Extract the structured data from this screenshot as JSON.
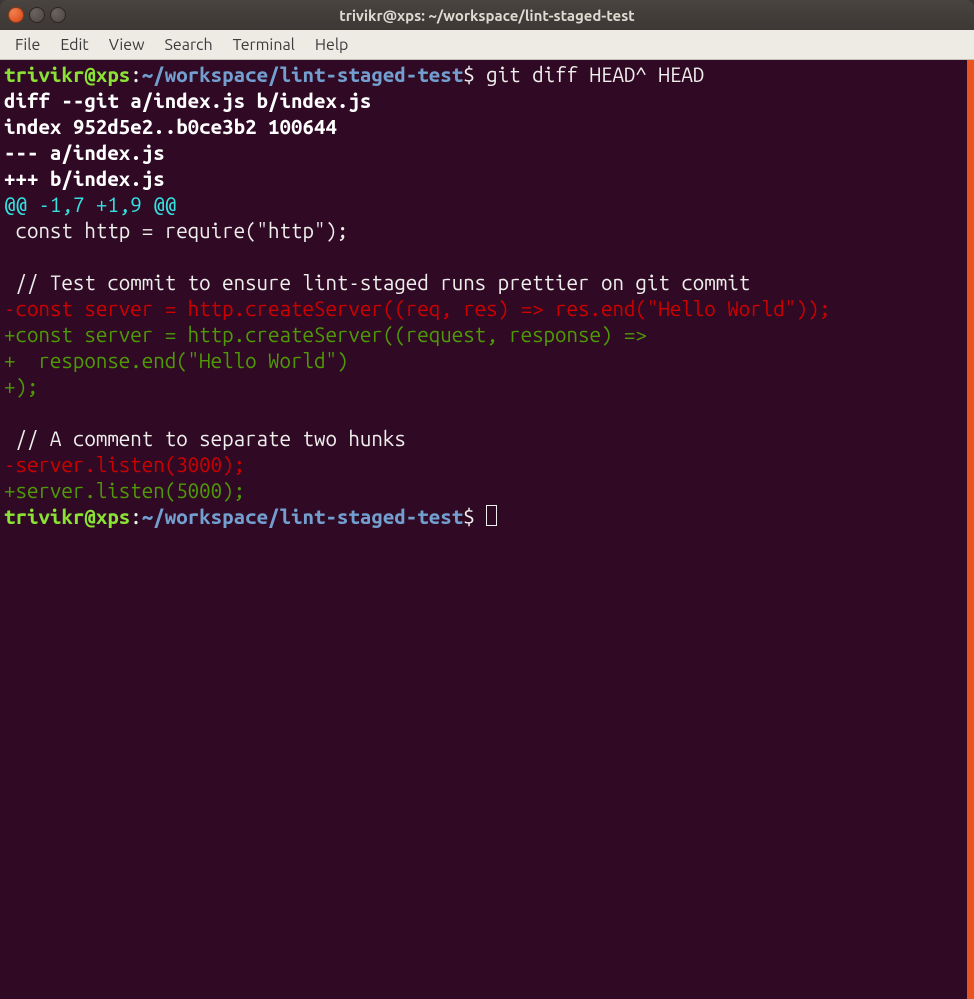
{
  "window": {
    "title": "trivikr@xps: ~/workspace/lint-staged-test"
  },
  "menubar": {
    "items": [
      "File",
      "Edit",
      "View",
      "Search",
      "Terminal",
      "Help"
    ]
  },
  "prompt": {
    "user_host": "trivikr@xps",
    "colon": ":",
    "path": "~/workspace/lint-staged-test",
    "dollar": "$"
  },
  "command": " git diff HEAD^ HEAD",
  "diff": {
    "header1": "diff --git a/index.js b/index.js",
    "header2": "index 952d5e2..b0ce3b2 100644",
    "header3": "--- a/index.js",
    "header4": "+++ b/index.js",
    "hunk": "@@ -1,7 +1,9 @@",
    "ctx1": " const http = require(\"http\");",
    "blank1": " ",
    "ctx2": " // Test commit to ensure lint-staged runs prettier on git commit",
    "del1": "-const server = http.createServer((req, res) => res.end(\"Hello World\"));",
    "add1": "+const server = http.createServer((request, response) =>",
    "add2": "+  response.end(\"Hello World\")",
    "add3": "+);",
    "blank2": " ",
    "ctx3": " // A comment to separate two hunks",
    "del2": "-server.listen(3000);",
    "add4": "+server.listen(5000);"
  }
}
